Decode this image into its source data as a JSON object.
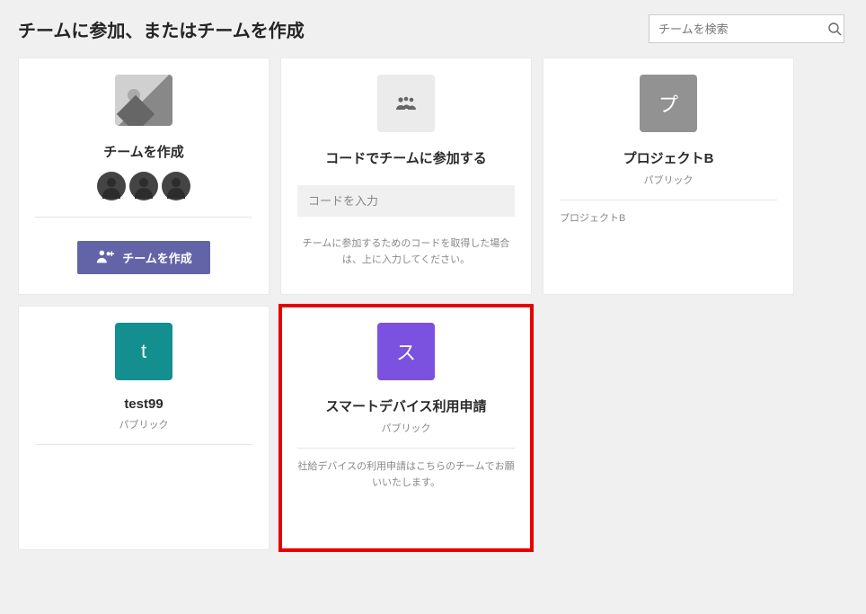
{
  "header": {
    "title": "チームに参加、またはチームを作成",
    "search_placeholder": "チームを検索"
  },
  "cards": {
    "create": {
      "title": "チームを作成",
      "button": "チームを作成"
    },
    "code": {
      "title": "コードでチームに参加する",
      "placeholder": "コードを入力",
      "desc": "チームに参加するためのコードを取得した場合は、上に入力してください。"
    },
    "project_b": {
      "tile_letter": "プ",
      "title": "プロジェクトB",
      "visibility": "パブリック",
      "desc": "プロジェクトB"
    },
    "test99": {
      "tile_letter": "t",
      "title": "test99",
      "visibility": "パブリック"
    },
    "smart": {
      "tile_letter": "ス",
      "title": "スマートデバイス利用申請",
      "visibility": "パブリック",
      "desc": "社給デバイスの利用申請はこちらのチームでお願いいたします。"
    }
  }
}
